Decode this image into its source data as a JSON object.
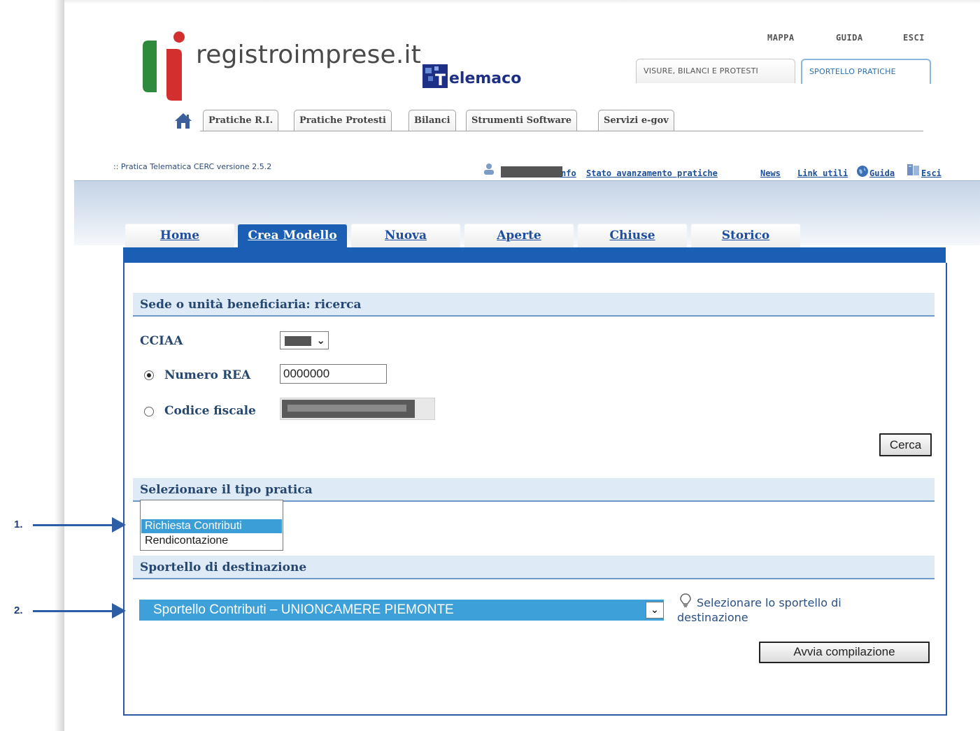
{
  "header": {
    "brand": "registroimprese.it",
    "telemaco": "elemaco",
    "telemaco_initial": "T",
    "top_links": [
      "MAPPA",
      "GUIDA",
      "ESCI"
    ],
    "upper_tabs": [
      "VISURE, BILANCI E PROTESTI",
      "SPORTELLO PRATICHE"
    ],
    "upper_tab_selected": "SPORTELLO PRATICHE",
    "nav_tabs": [
      "Pratiche R.I.",
      "Pratiche Protesti",
      "Bilanci",
      "Strumenti Software",
      "Servizi e-gov"
    ]
  },
  "info_bar": {
    "version": ":: Pratica Telematica CERC versione 2.5.2",
    "links": [
      "nfo",
      "Stato avanzamento pratiche",
      "News",
      "Link utili",
      "Guida",
      "Esci"
    ]
  },
  "main_tabs": {
    "items": [
      "Home",
      "Crea Modello",
      "Nuova",
      "Aperte",
      "Chiuse",
      "Storico"
    ],
    "selected": "Crea Modello"
  },
  "search": {
    "title": "Sede o unità beneficiaria: ricerca",
    "cciaa_label": "CCIAA",
    "numero_rea_label": "Numero REA",
    "numero_rea_value": "0000000",
    "codice_fiscale_label": "Codice fiscale",
    "selected_radio": "Numero REA",
    "search_button": "Cerca"
  },
  "tipo_pratica": {
    "title": "Selezionare il tipo pratica",
    "options": [
      "",
      "Richiesta Contributi",
      "Rendicontazione"
    ],
    "selected": "Richiesta Contributi"
  },
  "sportello": {
    "title": "Sportello di destinazione",
    "selected_value": "Sportello Contributi – UNIONCAMERE PIEMONTE",
    "hint": "Selezionare lo sportello di destinazione",
    "start_button": "Avvia compilazione"
  },
  "annotations": {
    "step1": "1.",
    "step2": "2."
  },
  "colors": {
    "accent_blue": "#1a5fb4",
    "section_bg": "#deebf7",
    "selection_blue": "#3ea0d8",
    "logo_green": "#2e8b3d",
    "logo_red": "#d32f2f"
  }
}
